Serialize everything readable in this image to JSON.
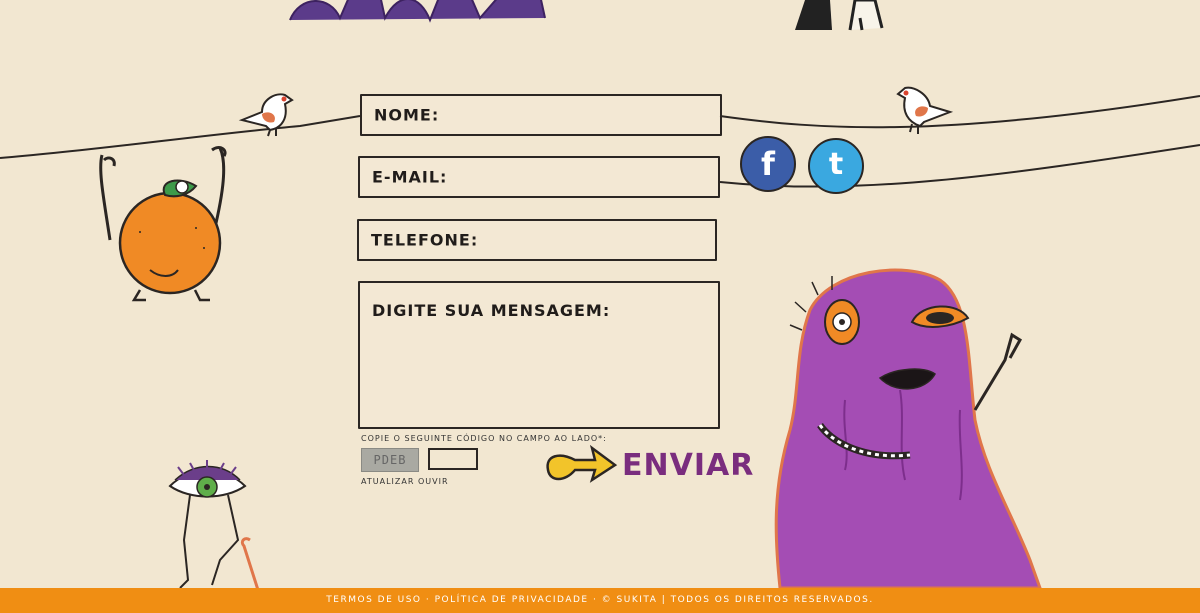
{
  "header": {
    "title_fragment": ""
  },
  "form": {
    "name_label": "NOME:",
    "email_label": "E-MAIL:",
    "phone_label": "TELEFONE:",
    "message_label": "DIGITE SUA MENSAGEM:"
  },
  "captcha": {
    "instruction": "COPIE O SEGUINTE CÓDIGO NO CAMPO AO LADO*:",
    "code": "PDEB",
    "refresh_label": "ATUALIZAR",
    "listen_label": "OUVIR"
  },
  "actions": {
    "send_label": "ENVIAR"
  },
  "social": {
    "facebook_glyph": "f",
    "twitter_glyph": "t"
  },
  "footer": {
    "text": "TERMOS DE USO · POLÍTICA DE PRIVACIDADE · © SUKITA | TODOS OS DIREITOS RESERVADOS."
  },
  "colors": {
    "background": "#f2e7d1",
    "footer": "#f08e13",
    "send": "#7a2d7e",
    "facebook": "#3b5da8",
    "twitter": "#3aa8e0",
    "monster": "#a44db4",
    "orange": "#f08a25"
  }
}
